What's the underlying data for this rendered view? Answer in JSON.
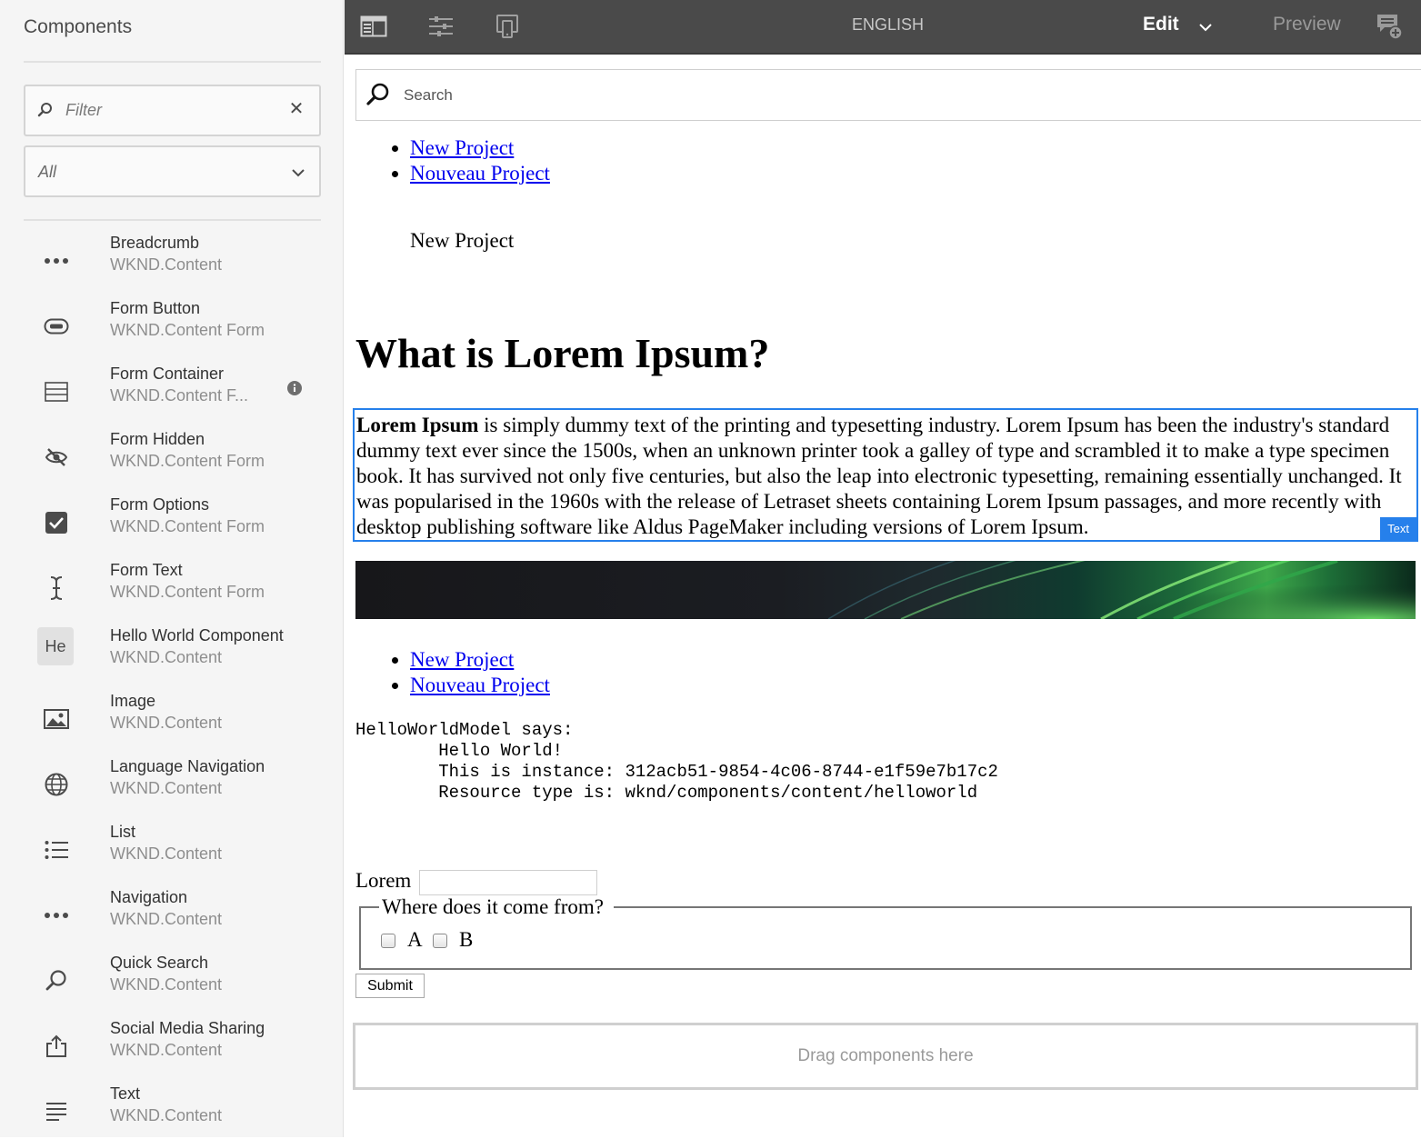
{
  "sidebar": {
    "title": "Components",
    "filter": {
      "placeholder": "Filter",
      "value": ""
    },
    "group_select": {
      "value": "All"
    },
    "components": [
      {
        "name": "Breadcrumb",
        "group": "WKND.Content",
        "icon": "more-dots-icon"
      },
      {
        "name": "Form Button",
        "group": "WKND.Content Form",
        "icon": "button-icon"
      },
      {
        "name": "Form Container",
        "group": "WKND.Content F...",
        "icon": "container-lines-icon",
        "has_info": true
      },
      {
        "name": "Form Hidden",
        "group": "WKND.Content Form",
        "icon": "eye-off-icon"
      },
      {
        "name": "Form Options",
        "group": "WKND.Content Form",
        "icon": "checkbox-checked-icon"
      },
      {
        "name": "Form Text",
        "group": "WKND.Content Form",
        "icon": "text-cursor-icon"
      },
      {
        "name": "Hello World Component",
        "group": "WKND.Content",
        "icon": "he-abbreviation-icon",
        "abbr": "He"
      },
      {
        "name": "Image",
        "group": "WKND.Content",
        "icon": "image-icon"
      },
      {
        "name": "Language Navigation",
        "group": "WKND.Content",
        "icon": "globe-icon"
      },
      {
        "name": "List",
        "group": "WKND.Content",
        "icon": "list-bullets-icon"
      },
      {
        "name": "Navigation",
        "group": "WKND.Content",
        "icon": "more-dots-icon"
      },
      {
        "name": "Quick Search",
        "group": "WKND.Content",
        "icon": "search-icon"
      },
      {
        "name": "Social Media Sharing",
        "group": "WKND.Content",
        "icon": "share-icon"
      },
      {
        "name": "Text",
        "group": "WKND.Content",
        "icon": "text-align-icon"
      }
    ]
  },
  "toolbar": {
    "language": "ENGLISH",
    "mode": "Edit",
    "preview": "Preview"
  },
  "page": {
    "search_placeholder": "Search",
    "language_links": [
      "New Project",
      "Nouveau Project"
    ],
    "breadcrumb_current": "New Project",
    "heading": "What is Lorem Ipsum?",
    "text_component": {
      "bold_lead": "Lorem Ipsum",
      "body": " is simply dummy text of the printing and typesetting industry. Lorem Ipsum has been the industry's standard dummy text ever since the 1500s, when an unknown printer took a galley of type and scrambled it to make a type specimen book. It has survived not only five centuries, but also the leap into electronic typesetting, remaining essentially unchanged. It was popularised in the 1960s with the release of Letraset sheets containing Lorem Ipsum passages, and more recently with desktop publishing software like Aldus PageMaker including versions of Lorem Ipsum.",
      "badge": "Text"
    },
    "nav_links": [
      "New Project",
      "Nouveau Project"
    ],
    "helloworld": {
      "line1": "HelloWorldModel says:",
      "line2": "        Hello World!",
      "line3": "        This is instance: 312acb51-9854-4c06-8744-e1f59e7b17c2",
      "line4": "        Resource type is: wknd/components/content/helloworld"
    },
    "form": {
      "text_label": "Lorem",
      "text_value": "",
      "legend": "Where does it come from?",
      "options": [
        "A",
        "B"
      ],
      "submit": "Submit"
    },
    "dropzone": "Drag components here"
  },
  "colors": {
    "toolbar_bg": "#4a4a4a",
    "selection_blue": "#2680eb",
    "link": "#0000ee"
  }
}
